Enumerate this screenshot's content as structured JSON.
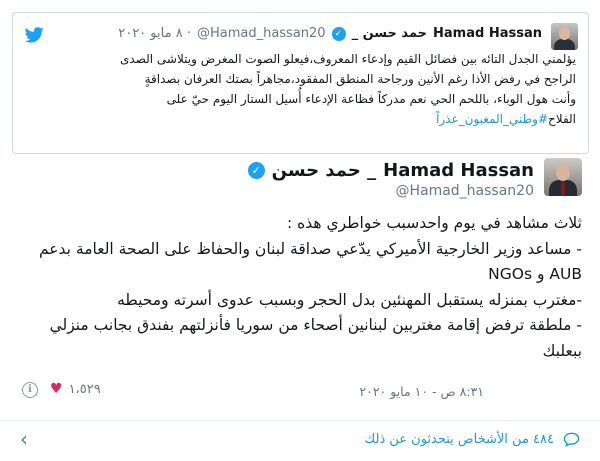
{
  "quoted_tweet": {
    "name": "Hamad Hassan",
    "name_ar": "_ حمد حسن",
    "handle": "@Hamad_hassan20",
    "date": "٨ مايو ٢٠٢٠ ·",
    "lines": [
      "يؤلمني الجدل التائه بين فضائل القيم وإدعاء المعروف،فيعلو الصوت المغرض ويتلاشى الصدى",
      "الراجح في رفض الأذا رغم الأنين ورجاحة المنطق المفقود،مجاهراً بصتك العرفان بصداقةٍ",
      "وأنت هول الوباء، باللحم الحي نعم مدركاً فظاعة الإدعاء أُسيل الستار اليوم حيّ على"
    ],
    "last_line_prefix": "الفلاح",
    "hashtag": "#وطني_المغبون_عذراً"
  },
  "main_tweet": {
    "name": "Hamad Hassan",
    "name_ar": "حمد حسن _",
    "handle": "@Hamad_hassan20",
    "lines": [
      "ثلاث مشاهد في يوم واحدسبب خواطري هذه :",
      "- مساعد وزير الخارجية الأميركي يدّعي صداقة لبنان والحفاظ على الصحة العامة بدعم",
      "AUB و NGOs",
      "-مغترب بمنزله يستقبل المهنئين بدل الحجر وبسبب عدوى أسرته ومحيطه",
      "- ملطقة ترفض إقامة مغتربين لبنانين أصحاء من سوريا فأنزلتهم بفندق بجانب منزلي",
      "ببعلبك"
    ],
    "timestamp": "٨:٣١ ص - ١٠ مايو ٢٠٢٠",
    "likes": "١،٥٢٩"
  },
  "replies": {
    "label": "٤٨٤ من الأشخاص يتحدثون عن ذلك"
  },
  "colors": {
    "accent": "#1da1f2",
    "link": "#1b95e0",
    "muted": "#657786",
    "like": "#e0245e"
  },
  "icons": [
    "twitter-bird-icon",
    "verified-badge-icon",
    "heart-icon",
    "info-icon",
    "chevron-left-icon",
    "speech-bubble-icon"
  ]
}
